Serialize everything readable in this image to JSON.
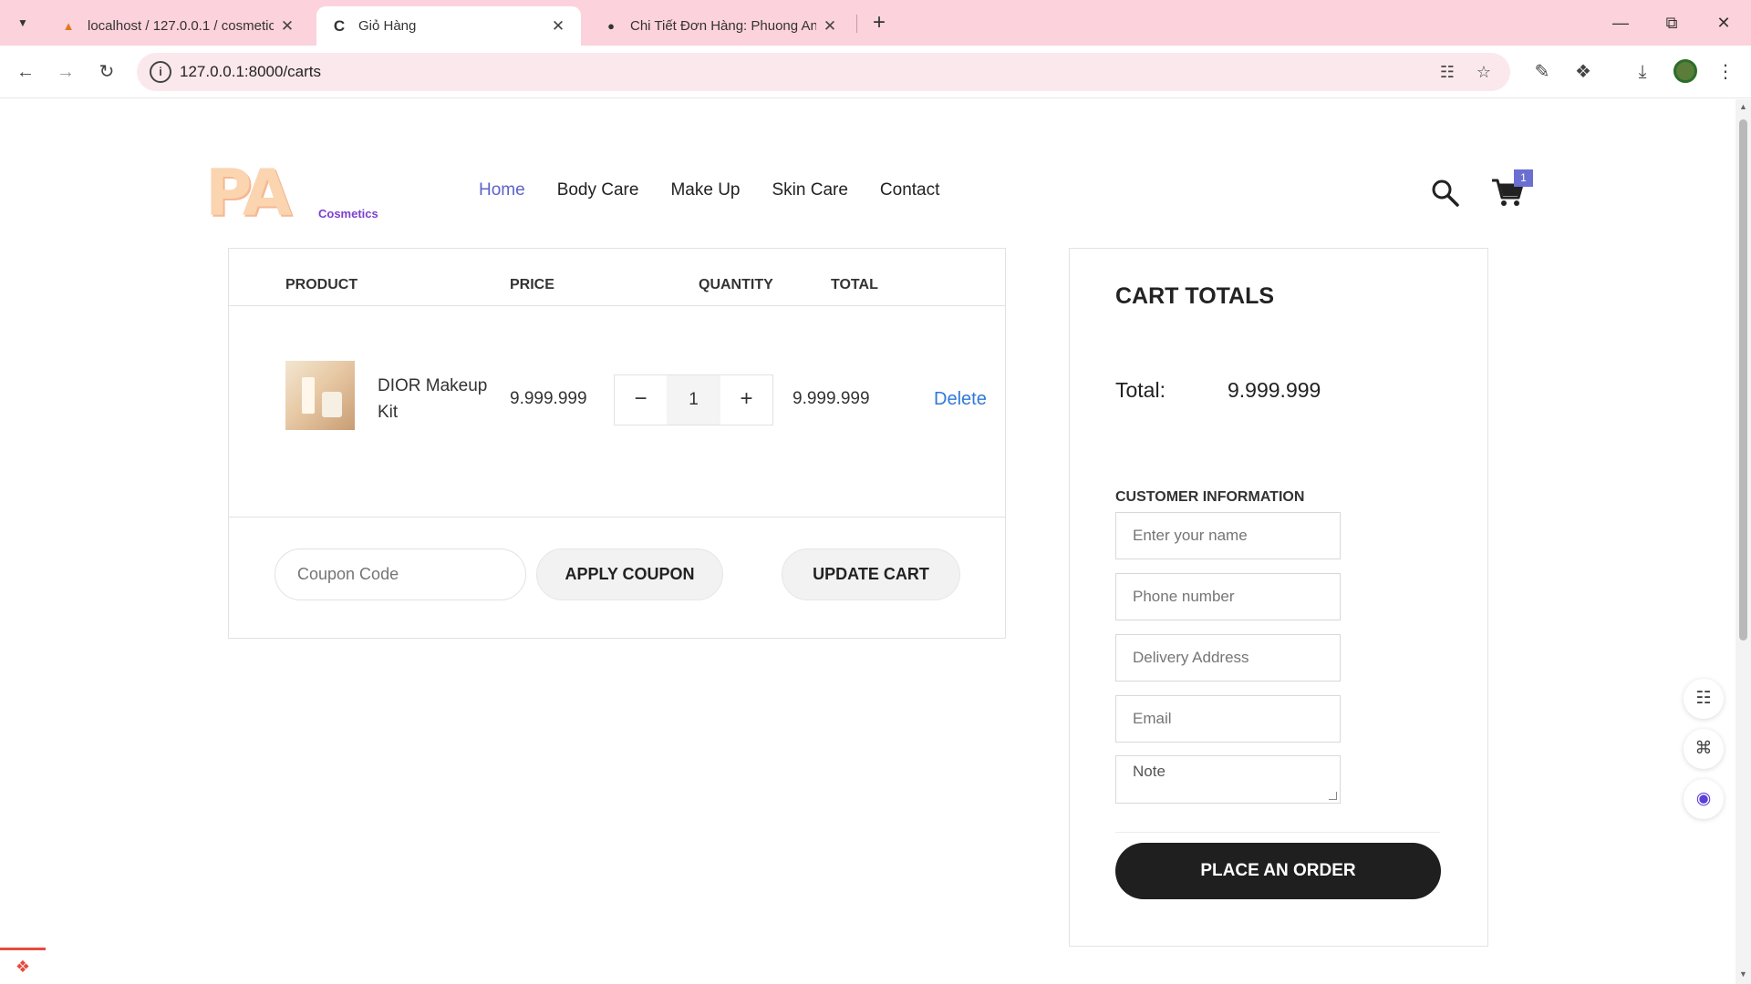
{
  "browser": {
    "tabs": [
      {
        "title": "localhost / 127.0.0.1 / cosmetic",
        "favicon": "phpmyadmin-icon",
        "active": false
      },
      {
        "title": "Giỏ Hàng",
        "favicon": "loading-icon",
        "active": true
      },
      {
        "title": "Chi Tiết Đơn Hàng: Phuong An",
        "favicon": "globe-icon",
        "active": false
      }
    ],
    "url": "127.0.0.1:8000/carts"
  },
  "header": {
    "logo_text": "PA",
    "logo_sub": "Cosmetics",
    "nav": [
      "Home",
      "Body Care",
      "Make Up",
      "Skin Care",
      "Contact"
    ],
    "active_nav": "Home",
    "cart_count": "1"
  },
  "cart": {
    "headers": {
      "product": "PRODUCT",
      "price": "PRICE",
      "quantity": "QUANTITY",
      "total": "TOTAL"
    },
    "items": [
      {
        "name": "DIOR Makeup Kit",
        "price": "9.999.999",
        "quantity": "1",
        "total": "9.999.999",
        "delete_label": "Delete"
      }
    ],
    "coupon_placeholder": "Coupon Code",
    "apply_coupon_label": "APPLY COUPON",
    "update_cart_label": "UPDATE CART"
  },
  "totals": {
    "title": "CART TOTALS",
    "total_label": "Total:",
    "total_value": "9.999.999",
    "customer_info_title": "CUSTOMER INFORMATION",
    "fields": {
      "name": "Enter your name",
      "phone": "Phone number",
      "address": "Delivery Address",
      "email": "Email",
      "note": "Note"
    },
    "place_order_label": "PLACE AN ORDER"
  },
  "colors": {
    "tabbar": "#fcd2dc",
    "nav_active": "#5c63c9",
    "delete_link": "#2f79d8",
    "order_button": "#1f1f1f",
    "cart_badge": "#6a6fd1"
  }
}
